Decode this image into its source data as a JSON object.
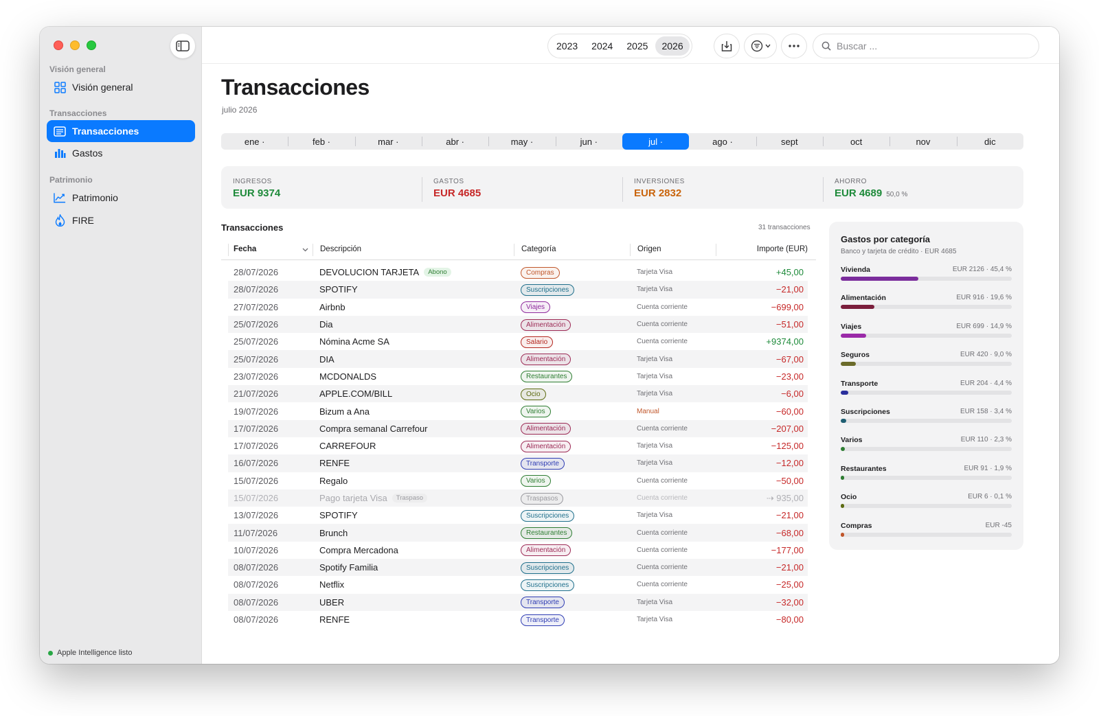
{
  "sidebar": {
    "sections": [
      {
        "label": "Visión general",
        "items": [
          {
            "label": "Visión general",
            "icon": "grid-icon"
          }
        ]
      },
      {
        "label": "Transacciones",
        "items": [
          {
            "label": "Transacciones",
            "icon": "list-icon",
            "active": true
          },
          {
            "label": "Gastos",
            "icon": "bar-chart-icon"
          }
        ]
      },
      {
        "label": "Patrimonio",
        "items": [
          {
            "label": "Patrimonio",
            "icon": "trend-icon"
          },
          {
            "label": "FIRE",
            "icon": "flame-icon"
          }
        ]
      }
    ],
    "status": "Apple Intelligence listo"
  },
  "toolbar": {
    "years": [
      "2023",
      "2024",
      "2025",
      "2026"
    ],
    "selected_year": "2026",
    "search_placeholder": "Buscar ..."
  },
  "page": {
    "title": "Transacciones",
    "subtitle": "julio 2026"
  },
  "months": [
    {
      "label": "ene ·"
    },
    {
      "label": "feb ·"
    },
    {
      "label": "mar ·"
    },
    {
      "label": "abr ·"
    },
    {
      "label": "may ·"
    },
    {
      "label": "jun ·"
    },
    {
      "label": "jul ·",
      "selected": true
    },
    {
      "label": "ago ·"
    },
    {
      "label": "sept"
    },
    {
      "label": "oct"
    },
    {
      "label": "nov"
    },
    {
      "label": "dic"
    }
  ],
  "summary": [
    {
      "label": "INGRESOS",
      "value": "EUR 9374",
      "color": "#1e8a3a"
    },
    {
      "label": "GASTOS",
      "value": "EUR 4685",
      "color": "#c62828"
    },
    {
      "label": "INVERSIONES",
      "value": "EUR 2832",
      "color": "#c9640c"
    },
    {
      "label": "AHORRO",
      "value": "EUR 4689",
      "note": "50,0 %",
      "color": "#1e8a3a"
    }
  ],
  "transactions": {
    "title": "Transacciones",
    "count": "31 transacciones",
    "columns": {
      "date": "Fecha",
      "desc": "Descripción",
      "cat": "Categoría",
      "origin": "Origen",
      "amount": "Importe (EUR)"
    },
    "rows": [
      {
        "date": "28/07/2026",
        "desc": "DEVOLUCION TARJETA",
        "tag": "Abono",
        "cat": "Compras",
        "origin": "Tarjeta Visa",
        "amount": "+45,00",
        "sign": "pos"
      },
      {
        "date": "28/07/2026",
        "desc": "SPOTIFY",
        "cat": "Suscripciones",
        "origin": "Tarjeta Visa",
        "amount": "−21,00",
        "sign": "neg"
      },
      {
        "date": "27/07/2026",
        "desc": "Airbnb",
        "cat": "Viajes",
        "origin": "Cuenta corriente",
        "amount": "−699,00",
        "sign": "neg"
      },
      {
        "date": "25/07/2026",
        "desc": "Dia",
        "cat": "Alimentación",
        "origin": "Cuenta corriente",
        "amount": "−51,00",
        "sign": "neg"
      },
      {
        "date": "25/07/2026",
        "desc": "Nómina Acme SA",
        "cat": "Salario",
        "origin": "Cuenta corriente",
        "amount": "+9374,00",
        "sign": "pos"
      },
      {
        "date": "25/07/2026",
        "desc": "DIA",
        "cat": "Alimentación",
        "origin": "Tarjeta Visa",
        "amount": "−67,00",
        "sign": "neg"
      },
      {
        "date": "23/07/2026",
        "desc": "MCDONALDS",
        "cat": "Restaurantes",
        "origin": "Tarjeta Visa",
        "amount": "−23,00",
        "sign": "neg"
      },
      {
        "date": "21/07/2026",
        "desc": "APPLE.COM/BILL",
        "cat": "Ocio",
        "origin": "Tarjeta Visa",
        "amount": "−6,00",
        "sign": "neg"
      },
      {
        "date": "19/07/2026",
        "desc": "Bizum a Ana",
        "cat": "Varios",
        "origin": "Manual",
        "origin_manual": true,
        "amount": "−60,00",
        "sign": "neg"
      },
      {
        "date": "17/07/2026",
        "desc": "Compra semanal Carrefour",
        "cat": "Alimentación",
        "origin": "Cuenta corriente",
        "amount": "−207,00",
        "sign": "neg"
      },
      {
        "date": "17/07/2026",
        "desc": "CARREFOUR",
        "cat": "Alimentación",
        "origin": "Tarjeta Visa",
        "amount": "−125,00",
        "sign": "neg"
      },
      {
        "date": "16/07/2026",
        "desc": "RENFE",
        "cat": "Transporte",
        "origin": "Tarjeta Visa",
        "amount": "−12,00",
        "sign": "neg"
      },
      {
        "date": "15/07/2026",
        "desc": "Regalo",
        "cat": "Varios",
        "origin": "Cuenta corriente",
        "amount": "−50,00",
        "sign": "neg"
      },
      {
        "date": "15/07/2026",
        "desc": "Pago tarjeta Visa",
        "tag": "Traspaso",
        "cat": "Traspasos",
        "origin": "Cuenta corriente",
        "amount": "⇢ 935,00",
        "sign": "dim"
      },
      {
        "date": "13/07/2026",
        "desc": "SPOTIFY",
        "cat": "Suscripciones",
        "origin": "Tarjeta Visa",
        "amount": "−21,00",
        "sign": "neg"
      },
      {
        "date": "11/07/2026",
        "desc": "Brunch",
        "cat": "Restaurantes",
        "origin": "Cuenta corriente",
        "amount": "−68,00",
        "sign": "neg"
      },
      {
        "date": "10/07/2026",
        "desc": "Compra Mercadona",
        "cat": "Alimentación",
        "origin": "Cuenta corriente",
        "amount": "−177,00",
        "sign": "neg"
      },
      {
        "date": "08/07/2026",
        "desc": "Spotify Familia",
        "cat": "Suscripciones",
        "origin": "Cuenta corriente",
        "amount": "−21,00",
        "sign": "neg"
      },
      {
        "date": "08/07/2026",
        "desc": "Netflix",
        "cat": "Suscripciones",
        "origin": "Cuenta corriente",
        "amount": "−25,00",
        "sign": "neg"
      },
      {
        "date": "08/07/2026",
        "desc": "UBER",
        "cat": "Transporte",
        "origin": "Tarjeta Visa",
        "amount": "−32,00",
        "sign": "neg"
      },
      {
        "date": "08/07/2026",
        "desc": "RENFE",
        "cat": "Transporte",
        "origin": "Tarjeta Visa",
        "amount": "−80,00",
        "sign": "neg"
      }
    ]
  },
  "category_colors": {
    "Compras": "#c0562a",
    "Suscripciones": "#1f6f8b",
    "Viajes": "#8e2a9c",
    "Alimentación": "#9c2a55",
    "Salario": "#b3261e",
    "Restaurantes": "#2e7d32",
    "Ocio": "#5d6b12",
    "Varios": "#2e7d32",
    "Transporte": "#2f3db3",
    "Traspasos": "#9a9a9f"
  },
  "categories_panel": {
    "title": "Gastos por categoría",
    "subtitle": "Banco y tarjeta de crédito · EUR 4685",
    "items": [
      {
        "name": "Vivienda",
        "value": "EUR 2126 · 45,4 %",
        "fraction": 0.454,
        "color": "#7b2d9c"
      },
      {
        "name": "Alimentación",
        "value": "EUR 916 · 19,6 %",
        "fraction": 0.196,
        "color": "#7b1e3c"
      },
      {
        "name": "Viajes",
        "value": "EUR 699 · 14,9 %",
        "fraction": 0.149,
        "color": "#9a2aa8"
      },
      {
        "name": "Seguros",
        "value": "EUR 420 · 9,0 %",
        "fraction": 0.09,
        "color": "#6b6b2a"
      },
      {
        "name": "Transporte",
        "value": "EUR 204 · 4,4 %",
        "fraction": 0.044,
        "color": "#2a2f9c"
      },
      {
        "name": "Suscripciones",
        "value": "EUR 158 · 3,4 %",
        "fraction": 0.034,
        "color": "#1f5f73"
      },
      {
        "name": "Varios",
        "value": "EUR 110 · 2,3 %",
        "fraction": 0.023,
        "color": "#2e7d32"
      },
      {
        "name": "Restaurantes",
        "value": "EUR 91 · 1,9 %",
        "fraction": 0.019,
        "color": "#2e7d32"
      },
      {
        "name": "Ocio",
        "value": "EUR 6 · 0,1 %",
        "fraction": 0.001,
        "color": "#5d6b12"
      },
      {
        "name": "Compras",
        "value": "EUR -45",
        "fraction": 0.0,
        "color": "#c0562a"
      }
    ]
  }
}
